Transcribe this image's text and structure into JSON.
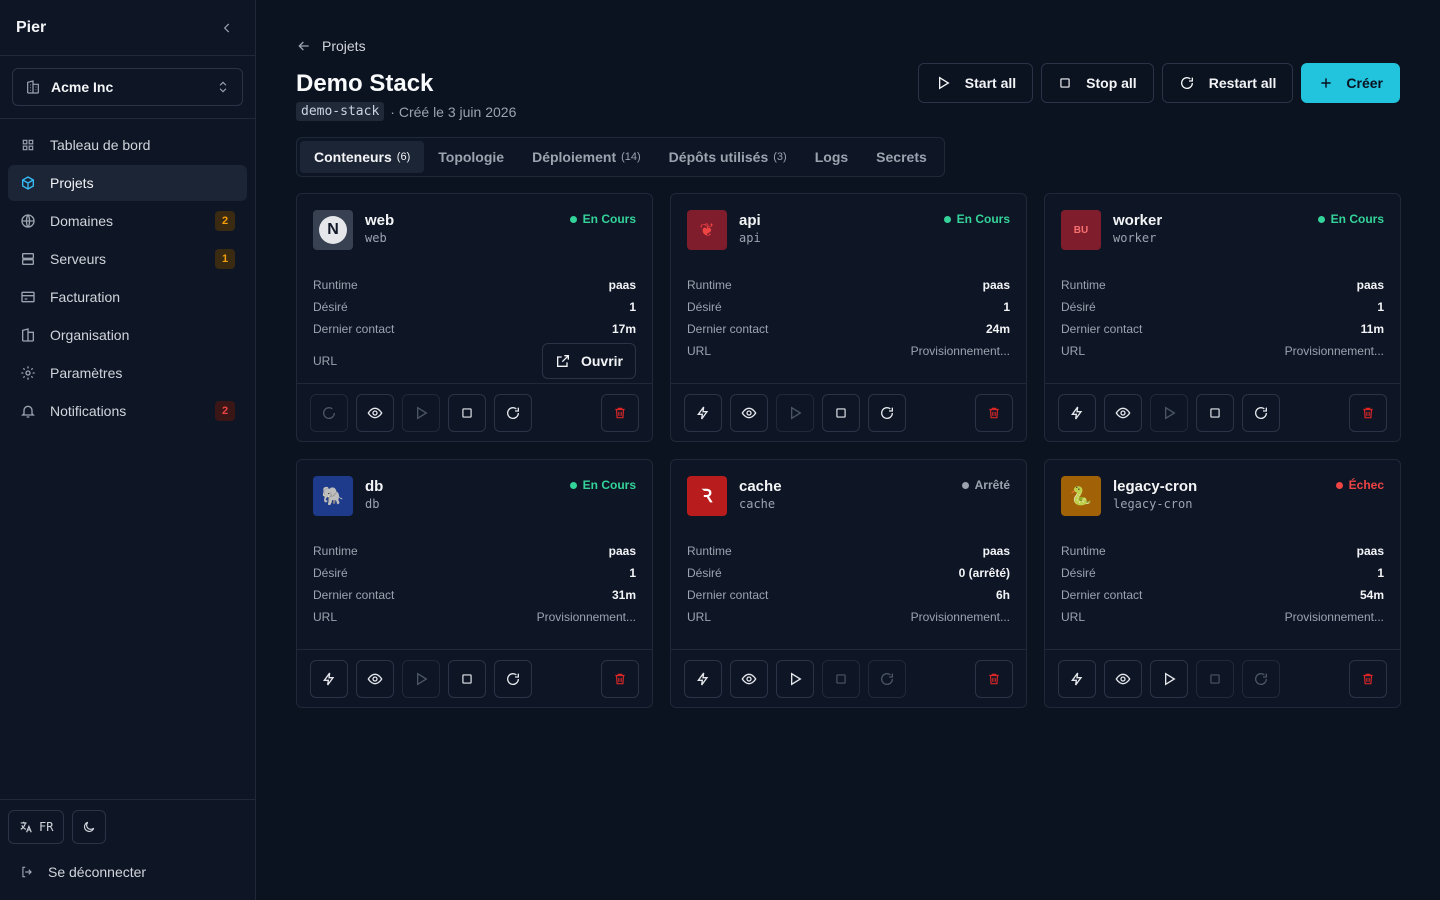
{
  "sidebar": {
    "brand": "Pier",
    "org": "Acme Inc",
    "items": [
      {
        "label": "Tableau de bord",
        "icon": "grid-icon",
        "active": false,
        "badge": ""
      },
      {
        "label": "Projets",
        "icon": "cube-icon",
        "active": true,
        "badge": ""
      },
      {
        "label": "Domaines",
        "icon": "globe-icon",
        "active": false,
        "badge": "2"
      },
      {
        "label": "Serveurs",
        "icon": "server-icon",
        "active": false,
        "badge": "1"
      },
      {
        "label": "Facturation",
        "icon": "card-icon",
        "active": false,
        "badge": ""
      },
      {
        "label": "Organisation",
        "icon": "building-icon",
        "active": false,
        "badge": ""
      },
      {
        "label": "Paramètres",
        "icon": "gear-icon",
        "active": false,
        "badge": ""
      },
      {
        "label": "Notifications",
        "icon": "bell-icon",
        "active": false,
        "badge": "2"
      }
    ],
    "lang": "FR",
    "logout": "Se déconnecter"
  },
  "header": {
    "breadcrumb": "Projets",
    "title": "Demo Stack",
    "slug": "demo-stack",
    "created": "· Créé le 3 juin 2026",
    "start_all": "Start all",
    "stop_all": "Stop all",
    "restart_all": "Restart all",
    "create": "Créer"
  },
  "tabs": [
    {
      "label": "Conteneurs",
      "count": "(6)",
      "active": true
    },
    {
      "label": "Topologie",
      "count": "",
      "active": false
    },
    {
      "label": "Déploiement",
      "count": "(14)",
      "active": false
    },
    {
      "label": "Dépôts utilisés",
      "count": "(3)",
      "active": false
    },
    {
      "label": "Logs",
      "count": "",
      "active": false
    },
    {
      "label": "Secrets",
      "count": "",
      "active": false
    }
  ],
  "labels": {
    "runtime": "Runtime",
    "desired": "Désiré",
    "last_contact": "Dernier contact",
    "url": "URL",
    "open": "Ouvrir"
  },
  "colors": {
    "accent": "#22c3dd",
    "running": "#34d399",
    "stopped": "#9ca3af",
    "failed": "#ef4444"
  },
  "containers": [
    {
      "name": "web",
      "slug": "web",
      "status": "En Cours",
      "status_kind": "running",
      "runtime": "paas",
      "desired": "1",
      "last_contact": "17m",
      "url": "",
      "has_open": true,
      "logo": "nextjs-logo",
      "logo_text": "N",
      "logo_bg": "#e5e7eb",
      "logo_fg": "#111827"
    },
    {
      "name": "api",
      "slug": "api",
      "status": "En Cours",
      "status_kind": "running",
      "runtime": "paas",
      "desired": "1",
      "last_contact": "24m",
      "url": "Provisionnement...",
      "has_open": false,
      "logo": "nestjs-logo",
      "logo_text": "❦",
      "logo_bg": "#7f1d2d",
      "logo_fg": "#ef4444"
    },
    {
      "name": "worker",
      "slug": "worker",
      "status": "En Cours",
      "status_kind": "running",
      "runtime": "paas",
      "desired": "1",
      "last_contact": "11m",
      "url": "Provisionnement...",
      "has_open": false,
      "logo": "bullmq-logo",
      "logo_text": "BU",
      "logo_bg": "#7f1d2d",
      "logo_fg": "#f87171"
    },
    {
      "name": "db",
      "slug": "db",
      "status": "En Cours",
      "status_kind": "running",
      "runtime": "paas",
      "desired": "1",
      "last_contact": "31m",
      "url": "Provisionnement...",
      "has_open": false,
      "logo": "postgres-logo",
      "logo_text": "🐘",
      "logo_bg": "#1e3a8a",
      "logo_fg": "#93c5fd"
    },
    {
      "name": "cache",
      "slug": "cache",
      "status": "Arrêté",
      "status_kind": "stopped",
      "runtime": "paas",
      "desired": "0 (arrêté)",
      "last_contact": "6h",
      "url": "Provisionnement...",
      "has_open": false,
      "logo": "redis-logo",
      "logo_text": "Ꝛ",
      "logo_bg": "#b91c1c",
      "logo_fg": "#ffffff"
    },
    {
      "name": "legacy-cron",
      "slug": "legacy-cron",
      "status": "Échec",
      "status_kind": "failed",
      "runtime": "paas",
      "desired": "1",
      "last_contact": "54m",
      "url": "Provisionnement...",
      "has_open": false,
      "logo": "python-logo",
      "logo_text": "🐍",
      "logo_bg": "#a16207",
      "logo_fg": "#fde68a"
    }
  ]
}
